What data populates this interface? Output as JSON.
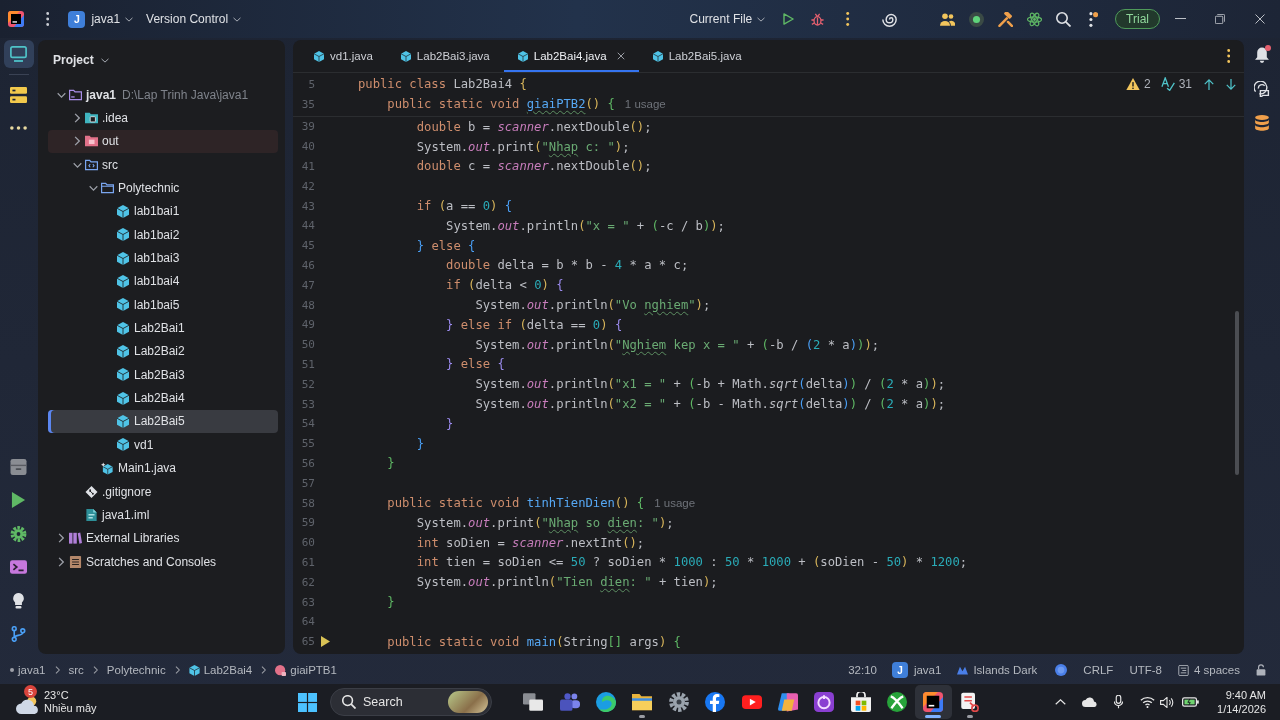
{
  "title_bar": {
    "project_badge": "J",
    "project": "java1",
    "vcs_menu": "Version Control",
    "run_configuration": "Current File",
    "trial_button": "Trial"
  },
  "left_toolbar": {
    "top": [
      {
        "kind": "project",
        "selected": true
      },
      {
        "kind": "structure",
        "selected": false
      },
      {
        "kind": "more",
        "selected": false
      }
    ],
    "bottom": [
      {
        "kind": "services",
        "selected": false
      },
      {
        "kind": "run",
        "selected": false
      },
      {
        "kind": "settings",
        "selected": false
      },
      {
        "kind": "terminal",
        "selected": false
      },
      {
        "kind": "problems",
        "selected": false
      },
      {
        "kind": "git",
        "selected": false
      }
    ]
  },
  "project_panel": {
    "title": "Project",
    "tree": [
      {
        "label": "java1",
        "path": "D:\\Lap Trinh Java\\java1",
        "kind": "module",
        "expanded": true,
        "selected": false,
        "children": [
          {
            "label": ".idea",
            "kind": "config-folder",
            "expanded": false,
            "selected": false
          },
          {
            "label": "out",
            "kind": "excluded-folder",
            "expanded": false,
            "selected": false
          },
          {
            "label": "src",
            "kind": "source-folder",
            "expanded": true,
            "selected": false,
            "children": [
              {
                "label": "Polytechnic",
                "kind": "package",
                "expanded": true,
                "selected": false,
                "children": [
                  {
                    "label": "lab1bai1",
                    "kind": "class",
                    "selected": false
                  },
                  {
                    "label": "lab1bai2",
                    "kind": "class",
                    "selected": false
                  },
                  {
                    "label": "lab1bai3",
                    "kind": "class",
                    "selected": false
                  },
                  {
                    "label": "lab1bai4",
                    "kind": "class",
                    "selected": false
                  },
                  {
                    "label": "lab1bai5",
                    "kind": "class",
                    "selected": false
                  },
                  {
                    "label": "Lab2Bai1",
                    "kind": "class",
                    "selected": false
                  },
                  {
                    "label": "Lab2Bai2",
                    "kind": "class",
                    "selected": false
                  },
                  {
                    "label": "Lab2Bai3",
                    "kind": "class",
                    "selected": false
                  },
                  {
                    "label": "Lab2Bai4",
                    "kind": "class",
                    "selected": false
                  },
                  {
                    "label": "Lab2Bai5",
                    "kind": "class",
                    "selected": true
                  },
                  {
                    "label": "vd1",
                    "kind": "class",
                    "selected": false
                  }
                ]
              },
              {
                "label": "Main1.java",
                "kind": "java-file",
                "selected": false
              }
            ]
          },
          {
            "label": ".gitignore",
            "kind": "ignore-file",
            "selected": false
          },
          {
            "label": "java1.iml",
            "kind": "module-file",
            "selected": false
          }
        ]
      },
      {
        "label": "External Libraries",
        "kind": "libraries",
        "expanded": false,
        "selected": false
      },
      {
        "label": "Scratches and Consoles",
        "kind": "scratches",
        "expanded": false,
        "selected": false
      }
    ]
  },
  "editor": {
    "tabs": [
      {
        "label": "vd1.java",
        "selected": false
      },
      {
        "label": "Lab2Bai3.java",
        "selected": false
      },
      {
        "label": "Lab2Bai4.java",
        "selected": true
      },
      {
        "label": "Lab2Bai5.java",
        "selected": false
      }
    ],
    "inspections": {
      "warnings": "2",
      "typos": "31"
    },
    "sticky_lines": [
      {
        "number": "5",
        "code": [
          {
            "kind": "keyword",
            "text": "public class"
          },
          {
            "kind": "plain",
            "text": " Lab2Bai4 "
          },
          {
            "kind": "bracket-1",
            "text": "{"
          }
        ]
      },
      {
        "number": "35",
        "code": [
          {
            "kind": "keyword",
            "text": "    public static void "
          },
          {
            "kind": "method-typo",
            "text": "giaiPTB2"
          },
          {
            "kind": "bracket-1",
            "text": "() "
          },
          {
            "kind": "bracket-2",
            "text": "{"
          }
        ],
        "hint": "1 usage"
      }
    ],
    "lines": [
      {
        "number": "39",
        "code": [
          {
            "kind": "keyword",
            "text": "        double"
          },
          {
            "kind": "plain",
            "text": " b = "
          },
          {
            "kind": "field",
            "text": "scanner"
          },
          {
            "kind": "plain",
            "text": ".nextDouble"
          },
          {
            "kind": "bracket-1",
            "text": "()"
          },
          {
            "kind": "plain",
            "text": ";"
          }
        ]
      },
      {
        "number": "40",
        "code": [
          {
            "kind": "plain",
            "text": "        System."
          },
          {
            "kind": "field",
            "text": "out"
          },
          {
            "kind": "plain",
            "text": ".print"
          },
          {
            "kind": "bracket-1",
            "text": "("
          },
          {
            "kind": "string",
            "text": "\""
          },
          {
            "kind": "string-typo",
            "text": "Nhap"
          },
          {
            "kind": "string",
            "text": " c: \""
          },
          {
            "kind": "bracket-1",
            "text": ")"
          },
          {
            "kind": "plain",
            "text": ";"
          }
        ]
      },
      {
        "number": "41",
        "code": [
          {
            "kind": "keyword",
            "text": "        double"
          },
          {
            "kind": "plain",
            "text": " c = "
          },
          {
            "kind": "field",
            "text": "scanner"
          },
          {
            "kind": "plain",
            "text": ".nextDouble"
          },
          {
            "kind": "bracket-1",
            "text": "()"
          },
          {
            "kind": "plain",
            "text": ";"
          }
        ]
      },
      {
        "number": "42"
      },
      {
        "number": "43",
        "code": [
          {
            "kind": "keyword",
            "text": "        if "
          },
          {
            "kind": "bracket-1",
            "text": "("
          },
          {
            "kind": "plain",
            "text": "a == "
          },
          {
            "kind": "number",
            "text": "0"
          },
          {
            "kind": "bracket-1",
            "text": ") "
          },
          {
            "kind": "bracket-3",
            "text": "{"
          }
        ]
      },
      {
        "number": "44",
        "code": [
          {
            "kind": "plain",
            "text": "            System."
          },
          {
            "kind": "field",
            "text": "out"
          },
          {
            "kind": "plain",
            "text": ".println"
          },
          {
            "kind": "bracket-1",
            "text": "("
          },
          {
            "kind": "string",
            "text": "\"x = \""
          },
          {
            "kind": "plain",
            "text": " + "
          },
          {
            "kind": "bracket-2",
            "text": "("
          },
          {
            "kind": "plain",
            "text": "-c / b"
          },
          {
            "kind": "bracket-2",
            "text": ")"
          },
          {
            "kind": "bracket-1",
            "text": ")"
          },
          {
            "kind": "plain",
            "text": ";"
          }
        ]
      },
      {
        "number": "45",
        "code": [
          {
            "kind": "bracket-3",
            "text": "        } "
          },
          {
            "kind": "keyword",
            "text": "else "
          },
          {
            "kind": "bracket-3",
            "text": "{"
          }
        ]
      },
      {
        "number": "46",
        "code": [
          {
            "kind": "keyword",
            "text": "            double"
          },
          {
            "kind": "plain",
            "text": " delta = b * b - "
          },
          {
            "kind": "number",
            "text": "4"
          },
          {
            "kind": "plain",
            "text": " * a * c;"
          }
        ]
      },
      {
        "number": "47",
        "code": [
          {
            "kind": "keyword",
            "text": "            if "
          },
          {
            "kind": "bracket-1",
            "text": "("
          },
          {
            "kind": "plain",
            "text": "delta < "
          },
          {
            "kind": "number",
            "text": "0"
          },
          {
            "kind": "bracket-1",
            "text": ") "
          },
          {
            "kind": "bracket-4",
            "text": "{"
          }
        ]
      },
      {
        "number": "48",
        "code": [
          {
            "kind": "plain",
            "text": "                System."
          },
          {
            "kind": "field",
            "text": "out"
          },
          {
            "kind": "plain",
            "text": ".println"
          },
          {
            "kind": "bracket-1",
            "text": "("
          },
          {
            "kind": "string",
            "text": "\"Vo "
          },
          {
            "kind": "string-typo",
            "text": "nghiem"
          },
          {
            "kind": "string",
            "text": "\""
          },
          {
            "kind": "bracket-1",
            "text": ")"
          },
          {
            "kind": "plain",
            "text": ";"
          }
        ]
      },
      {
        "number": "49",
        "code": [
          {
            "kind": "bracket-4",
            "text": "            } "
          },
          {
            "kind": "keyword",
            "text": "else if "
          },
          {
            "kind": "bracket-1",
            "text": "("
          },
          {
            "kind": "plain",
            "text": "delta == "
          },
          {
            "kind": "number",
            "text": "0"
          },
          {
            "kind": "bracket-1",
            "text": ") "
          },
          {
            "kind": "bracket-4",
            "text": "{"
          }
        ]
      },
      {
        "number": "50",
        "code": [
          {
            "kind": "plain",
            "text": "                System."
          },
          {
            "kind": "field",
            "text": "out"
          },
          {
            "kind": "plain",
            "text": ".println"
          },
          {
            "kind": "bracket-1",
            "text": "("
          },
          {
            "kind": "string",
            "text": "\""
          },
          {
            "kind": "string-typo",
            "text": "Nghiem"
          },
          {
            "kind": "string",
            "text": " kep x = \""
          },
          {
            "kind": "plain",
            "text": " + "
          },
          {
            "kind": "bracket-2",
            "text": "("
          },
          {
            "kind": "plain",
            "text": "-b / "
          },
          {
            "kind": "bracket-3",
            "text": "("
          },
          {
            "kind": "number",
            "text": "2"
          },
          {
            "kind": "plain",
            "text": " * a"
          },
          {
            "kind": "bracket-3",
            "text": ")"
          },
          {
            "kind": "bracket-2",
            "text": ")"
          },
          {
            "kind": "bracket-1",
            "text": ")"
          },
          {
            "kind": "plain",
            "text": ";"
          }
        ]
      },
      {
        "number": "51",
        "code": [
          {
            "kind": "bracket-4",
            "text": "            } "
          },
          {
            "kind": "keyword",
            "text": "else "
          },
          {
            "kind": "bracket-4",
            "text": "{"
          }
        ]
      },
      {
        "number": "52",
        "code": [
          {
            "kind": "plain",
            "text": "                System."
          },
          {
            "kind": "field",
            "text": "out"
          },
          {
            "kind": "plain",
            "text": ".println"
          },
          {
            "kind": "bracket-1",
            "text": "("
          },
          {
            "kind": "string",
            "text": "\"x1 = \""
          },
          {
            "kind": "plain",
            "text": " + "
          },
          {
            "kind": "bracket-2",
            "text": "("
          },
          {
            "kind": "plain",
            "text": "-b + Math."
          },
          {
            "kind": "italic",
            "text": "sqrt"
          },
          {
            "kind": "bracket-3",
            "text": "("
          },
          {
            "kind": "plain",
            "text": "delta"
          },
          {
            "kind": "bracket-3",
            "text": ")"
          },
          {
            "kind": "bracket-2",
            "text": ")"
          },
          {
            "kind": "plain",
            "text": " / "
          },
          {
            "kind": "bracket-2",
            "text": "("
          },
          {
            "kind": "number",
            "text": "2"
          },
          {
            "kind": "plain",
            "text": " * a"
          },
          {
            "kind": "bracket-2",
            "text": ")"
          },
          {
            "kind": "bracket-1",
            "text": ")"
          },
          {
            "kind": "plain",
            "text": ";"
          }
        ]
      },
      {
        "number": "53",
        "code": [
          {
            "kind": "plain",
            "text": "                System."
          },
          {
            "kind": "field",
            "text": "out"
          },
          {
            "kind": "plain",
            "text": ".println"
          },
          {
            "kind": "bracket-1",
            "text": "("
          },
          {
            "kind": "string",
            "text": "\"x2 = \""
          },
          {
            "kind": "plain",
            "text": " + "
          },
          {
            "kind": "bracket-2",
            "text": "("
          },
          {
            "kind": "plain",
            "text": "-b - Math."
          },
          {
            "kind": "italic",
            "text": "sqrt"
          },
          {
            "kind": "bracket-3",
            "text": "("
          },
          {
            "kind": "plain",
            "text": "delta"
          },
          {
            "kind": "bracket-3",
            "text": ")"
          },
          {
            "kind": "bracket-2",
            "text": ")"
          },
          {
            "kind": "plain",
            "text": " / "
          },
          {
            "kind": "bracket-2",
            "text": "("
          },
          {
            "kind": "number",
            "text": "2"
          },
          {
            "kind": "plain",
            "text": " * a"
          },
          {
            "kind": "bracket-2",
            "text": ")"
          },
          {
            "kind": "bracket-1",
            "text": ")"
          },
          {
            "kind": "plain",
            "text": ";"
          }
        ]
      },
      {
        "number": "54",
        "code": [
          {
            "kind": "bracket-4",
            "text": "            }"
          }
        ]
      },
      {
        "number": "55",
        "code": [
          {
            "kind": "bracket-3",
            "text": "        }"
          }
        ]
      },
      {
        "number": "56",
        "code": [
          {
            "kind": "bracket-2",
            "text": "    }"
          }
        ]
      },
      {
        "number": "57"
      },
      {
        "number": "58",
        "code": [
          {
            "kind": "keyword",
            "text": "    public static void "
          },
          {
            "kind": "method",
            "text": "tinhTienDien"
          },
          {
            "kind": "bracket-1",
            "text": "() "
          },
          {
            "kind": "bracket-2",
            "text": "{"
          }
        ],
        "hint": "1 usage"
      },
      {
        "number": "59",
        "code": [
          {
            "kind": "plain",
            "text": "        System."
          },
          {
            "kind": "field",
            "text": "out"
          },
          {
            "kind": "plain",
            "text": ".print"
          },
          {
            "kind": "bracket-1",
            "text": "("
          },
          {
            "kind": "string",
            "text": "\""
          },
          {
            "kind": "string-typo",
            "text": "Nhap"
          },
          {
            "kind": "string",
            "text": " so "
          },
          {
            "kind": "string-typo",
            "text": "dien"
          },
          {
            "kind": "string",
            "text": ": \""
          },
          {
            "kind": "bracket-1",
            "text": ")"
          },
          {
            "kind": "plain",
            "text": ";"
          }
        ]
      },
      {
        "number": "60",
        "code": [
          {
            "kind": "keyword",
            "text": "        int"
          },
          {
            "kind": "plain",
            "text": " soDien = "
          },
          {
            "kind": "field",
            "text": "scanner"
          },
          {
            "kind": "plain",
            "text": ".nextInt"
          },
          {
            "kind": "bracket-1",
            "text": "()"
          },
          {
            "kind": "plain",
            "text": ";"
          }
        ]
      },
      {
        "number": "61",
        "code": [
          {
            "kind": "keyword",
            "text": "        int"
          },
          {
            "kind": "plain",
            "text": " tien = soDien <= "
          },
          {
            "kind": "number",
            "text": "50"
          },
          {
            "kind": "plain",
            "text": " ? soDien * "
          },
          {
            "kind": "number",
            "text": "1000"
          },
          {
            "kind": "plain",
            "text": " : "
          },
          {
            "kind": "number",
            "text": "50"
          },
          {
            "kind": "plain",
            "text": " * "
          },
          {
            "kind": "number",
            "text": "1000"
          },
          {
            "kind": "plain",
            "text": " + "
          },
          {
            "kind": "bracket-1",
            "text": "("
          },
          {
            "kind": "plain",
            "text": "soDien - "
          },
          {
            "kind": "number",
            "text": "50"
          },
          {
            "kind": "bracket-1",
            "text": ")"
          },
          {
            "kind": "plain",
            "text": " * "
          },
          {
            "kind": "number",
            "text": "1200"
          },
          {
            "kind": "plain",
            "text": ";"
          }
        ]
      },
      {
        "number": "62",
        "code": [
          {
            "kind": "plain",
            "text": "        System."
          },
          {
            "kind": "field",
            "text": "out"
          },
          {
            "kind": "plain",
            "text": ".println"
          },
          {
            "kind": "bracket-1",
            "text": "("
          },
          {
            "kind": "string",
            "text": "\"Tien "
          },
          {
            "kind": "string-typo",
            "text": "dien"
          },
          {
            "kind": "string",
            "text": ": \""
          },
          {
            "kind": "plain",
            "text": " + tien"
          },
          {
            "kind": "bracket-1",
            "text": ")"
          },
          {
            "kind": "plain",
            "text": ";"
          }
        ]
      },
      {
        "number": "63",
        "code": [
          {
            "kind": "bracket-2",
            "text": "    }"
          }
        ]
      },
      {
        "number": "64"
      },
      {
        "number": "65",
        "marker": {
          "kind": "run"
        },
        "code": [
          {
            "kind": "keyword",
            "text": "    public static void "
          },
          {
            "kind": "method",
            "text": "main"
          },
          {
            "kind": "bracket-1",
            "text": "("
          },
          {
            "kind": "plain",
            "text": "String"
          },
          {
            "kind": "bracket-2",
            "text": "[]"
          },
          {
            "kind": "plain",
            "text": " args"
          },
          {
            "kind": "bracket-1",
            "text": ") "
          },
          {
            "kind": "bracket-2",
            "text": "{"
          }
        ]
      }
    ]
  },
  "right_toolbar": [
    {
      "kind": "notifications",
      "unread": true
    },
    {
      "kind": "ai-chat",
      "unread": false
    },
    {
      "kind": "database",
      "unread": false
    }
  ],
  "status_bar": {
    "breadcrumbs": [
      {
        "label": "java1",
        "kind": "module"
      },
      {
        "label": "src",
        "kind": "folder"
      },
      {
        "label": "Polytechnic",
        "kind": "package"
      },
      {
        "label": "Lab2Bai4",
        "kind": "class"
      },
      {
        "label": "giaiPTB1",
        "kind": "method"
      }
    ],
    "caret_position": "32:10",
    "project_badge": "J",
    "project": "java1",
    "theme": "Islands Dark",
    "line_separator": "CRLF",
    "encoding": "UTF-8",
    "indent": "4 spaces"
  },
  "taskbar": {
    "weather": {
      "badge": "5",
      "temperature": "23°C",
      "condition": "Nhiều mây"
    },
    "search": {
      "placeholder": "Search"
    },
    "apps": [
      {
        "kind": "task-view",
        "selected": false,
        "running": false
      },
      {
        "kind": "chat",
        "selected": false,
        "running": false
      },
      {
        "kind": "browser",
        "selected": false,
        "running": false
      },
      {
        "kind": "files",
        "selected": false,
        "running": true
      },
      {
        "kind": "settings",
        "selected": false,
        "running": false
      },
      {
        "kind": "social",
        "selected": false,
        "running": false
      },
      {
        "kind": "video",
        "selected": false,
        "running": false
      },
      {
        "kind": "assistant",
        "selected": false,
        "running": false
      },
      {
        "kind": "purple-app",
        "selected": false,
        "running": false
      },
      {
        "kind": "store",
        "selected": false,
        "running": false
      },
      {
        "kind": "game",
        "selected": false,
        "running": false
      },
      {
        "kind": "ide",
        "selected": true,
        "running": true
      },
      {
        "kind": "snipping",
        "selected": false,
        "running": true
      }
    ],
    "time": "9:40 AM",
    "date": "1/14/2026"
  }
}
